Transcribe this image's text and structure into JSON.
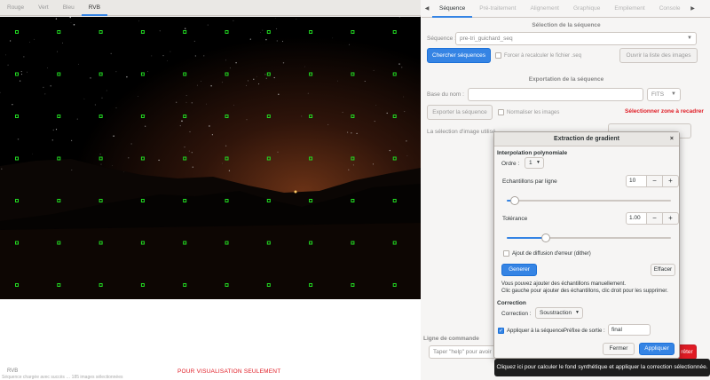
{
  "viewer": {
    "tabs": [
      "Rouge",
      "Vert",
      "Bleu",
      "RVB"
    ],
    "active_tab": "RVB",
    "channel_label": "RVB",
    "watermark": "POUR VISUALISATION SEULEMENT",
    "sample_color": "#22dd22",
    "status_text": "Séquence chargée avec succès … 185 images sélectionnées"
  },
  "right": {
    "tabs": [
      "Séquence",
      "Pré-traitement",
      "Alignement",
      "Graphique",
      "Empilement",
      "Console"
    ],
    "active_tab": "Séquence",
    "sequence_section": {
      "title": "Sélection de la séquence",
      "label": "Séquence :",
      "value": "pre-tri_guichard_seq",
      "search_button": "Chercher séquences",
      "force_checkbox": "Forcer à recalculer le fichier .seq",
      "open_list_button": "Ouvrir la liste des images"
    },
    "export_section": {
      "title": "Exportation de la séquence",
      "base_name_label": "Base du nom :",
      "format_value": "FITS",
      "export_button": "Exporter la séquence",
      "normalize_checkbox": "Normaliser les images",
      "select_zone_text": "Sélectionner zone à recadrer",
      "selection_text": "La sélection d'image utilisé"
    },
    "command_line": {
      "title": "Ligne de commande",
      "placeholder": "Taper \"help\" pour avoir",
      "stop_label": "rêter"
    }
  },
  "dialog": {
    "title": "Extraction de gradient",
    "close_glyph": "×",
    "interp_title": "Interpolation polynomiale",
    "order_label": "Ordre :",
    "order_value": "1",
    "samples_label": "Echantillons par ligne",
    "samples_value": "10",
    "samples_slider": 0.05,
    "tolerance_label": "Tolérance",
    "tolerance_value": "1.00",
    "tolerance_slider": 0.24,
    "dither_checkbox": "Ajout de diffusion d'erreur (dither)",
    "generate_button": "Generer",
    "clear_button": "Effacer",
    "help_line1": "Vous pouvez ajouter des échantillons manuellement.",
    "help_line2": "Clic gauche pour ajouter des échantillons, clic droit pour les supprimer.",
    "correction_title": "Correction",
    "correction_label": "Correction :",
    "correction_value": "Soustraction",
    "apply_seq_checkbox": "Appliquer à la séquence",
    "prefix_label": "Préfixe de sortie :",
    "prefix_value": "final",
    "close_button": "Fermer",
    "apply_button": "Appliquer",
    "minus": "−",
    "plus": "+"
  },
  "tooltip": "Cliquez ici pour calculer le fond synthétique et appliquer la correction sélectionnée."
}
